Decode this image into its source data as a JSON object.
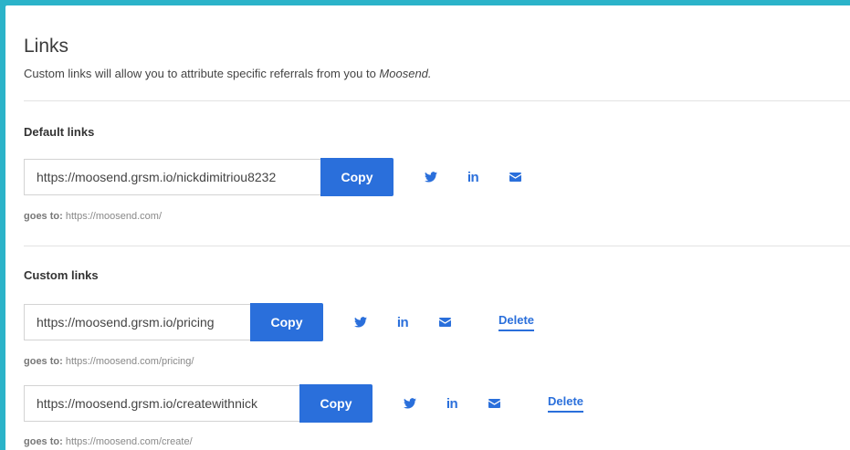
{
  "header": {
    "title": "Links",
    "subtitle_prefix": "Custom links will allow you to attribute specific referrals from you to ",
    "subtitle_brand": "Moosend."
  },
  "default_section": {
    "heading": "Default links",
    "links": [
      {
        "url": "https://moosend.grsm.io/nickdimitriou8232",
        "copy_label": "Copy",
        "goes_to_label": "goes to:",
        "goes_to_url": "https://moosend.com/"
      }
    ]
  },
  "custom_section": {
    "heading": "Custom links",
    "links": [
      {
        "url": "https://moosend.grsm.io/pricing",
        "copy_label": "Copy",
        "delete_label": "Delete",
        "goes_to_label": "goes to:",
        "goes_to_url": "https://moosend.com/pricing/"
      },
      {
        "url": "https://moosend.grsm.io/createwithnick",
        "copy_label": "Copy",
        "delete_label": "Delete",
        "goes_to_label": "goes to:",
        "goes_to_url": "https://moosend.com/create/"
      }
    ]
  },
  "social_icons": [
    "twitter-icon",
    "linkedin-icon",
    "email-icon"
  ],
  "colors": {
    "accent": "#2a6fdb",
    "background": "#2bb3c9",
    "panel": "#ffffff"
  }
}
